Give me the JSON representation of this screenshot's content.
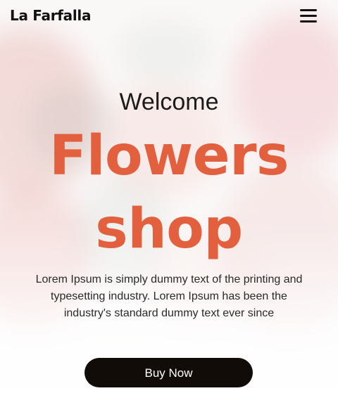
{
  "header": {
    "brand": "La Farfalla",
    "menu_icon": "hamburger-menu-icon"
  },
  "hero": {
    "welcome": "Welcome",
    "title_line_1": "Flowers",
    "title_line_2": "shop",
    "description_lines": [
      "Lorem Ipsum is simply dummy text of the printing and",
      "typesetting industry. Lorem Ipsum has been the",
      "industry's standard dummy text ever since"
    ],
    "cta_label": "Buy Now"
  },
  "colors": {
    "accent": "#e2603d",
    "button_background": "#120c08",
    "text_dark": "#111111"
  }
}
